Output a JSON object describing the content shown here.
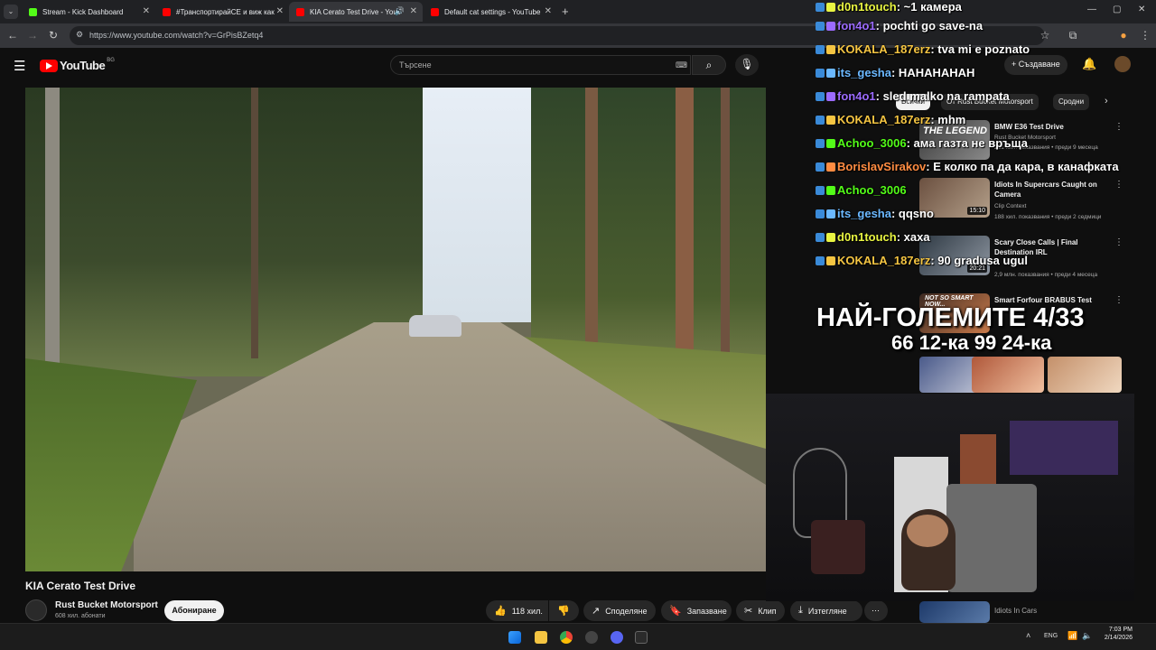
{
  "browser": {
    "tabs": [
      {
        "label": "Stream - Kick Dashboard",
        "color": "#53fc18"
      },
      {
        "label": "#ТранспортирайСЕ и виж как",
        "color": "#ff0000"
      },
      {
        "label": "KIA Cerato Test Drive - YouT",
        "color": "#ff0000"
      },
      {
        "label": "Default cat settings - YouTube",
        "color": "#ff0000"
      }
    ],
    "url": "https://www.youtube.com/watch?v=GrPisBZetq4"
  },
  "youtube": {
    "logo": "YouTube",
    "region": "BG",
    "search_placeholder": "Търсене",
    "create_label": "Създаване",
    "video_title": "KIA Cerato Test Drive",
    "channel": "Rust Bucket Motorsport",
    "subscribers": "608 хил. абонати",
    "subscribe_label": "Абониране",
    "likes": "118 хил.",
    "share_label": "Споделяне",
    "save_label": "Запазване",
    "clip_label": "Клип",
    "download_label": "Изтегляне",
    "chips": [
      "Всички",
      "От Rust Bucket Motorsport",
      "Сродни"
    ],
    "recommended": [
      {
        "title": "BMW E36 Test Drive",
        "channel": "Rust Bucket Motorsport",
        "meta": "281 хил. показвания • преди 9 месеца",
        "duration": ""
      },
      {
        "title": "Idiots In Supercars Caught on Camera",
        "channel": "Clip Context",
        "meta": "188 хил. показвания • преди 2 седмици",
        "duration": "15:10"
      },
      {
        "title": "Scary Close Calls | Final Destination IRL",
        "channel": "",
        "meta": "2,9 млн. показвания • преди 4 месеца",
        "duration": "20:21"
      },
      {
        "title": "Smart Forfour BRABUS Test",
        "channel": "",
        "meta": "",
        "duration": ""
      },
      {
        "title": "",
        "channel": "Idiots In Cars",
        "meta": "",
        "duration": ""
      }
    ],
    "thumb_overlay_text": "NOT SO SMART NOW..."
  },
  "chat": [
    {
      "user": "d0n1touch",
      "msg": ": ~1 камера",
      "color": "#e9f542"
    },
    {
      "user": "fon4o1",
      "msg": ": pochti go save-na",
      "color": "#9c6bff"
    },
    {
      "user": "KOKALA_187erz",
      "msg": ": tva mi e poznato",
      "color": "#f5c542"
    },
    {
      "user": "its_gesha",
      "msg": ": HAHAHAHAH",
      "color": "#6bb8ff"
    },
    {
      "user": "fon4o1",
      "msg": ": sled malko na rampata",
      "color": "#9c6bff"
    },
    {
      "user": "KOKALA_187erz",
      "msg": ": mhm",
      "color": "#f5c542"
    },
    {
      "user": "Achoo_3006",
      "msg": ": ама газта не връща",
      "color": "#53fc18"
    },
    {
      "user": "BorislavSirakov",
      "msg": ": Е колко па да кара, в канафката",
      "color": "#ff8c42"
    },
    {
      "user": "Achoo_3006",
      "msg": "",
      "color": "#53fc18"
    },
    {
      "user": "its_gesha",
      "msg": ": qqsno",
      "color": "#6bb8ff"
    },
    {
      "user": "d0n1touch",
      "msg": ": хаха",
      "color": "#e9f542"
    },
    {
      "user": "KOKALA_187erz",
      "msg": ": 90 gradusa ugul",
      "color": "#f5c542"
    }
  ],
  "overlay": {
    "title": "НАЙ-ГОЛЕМИТЕ 4/33",
    "subtitle": "66 12-ка 99 24-ка"
  },
  "taskbar": {
    "lang": "ENG",
    "time": "7:03 PM",
    "date": "2/14/2026"
  }
}
